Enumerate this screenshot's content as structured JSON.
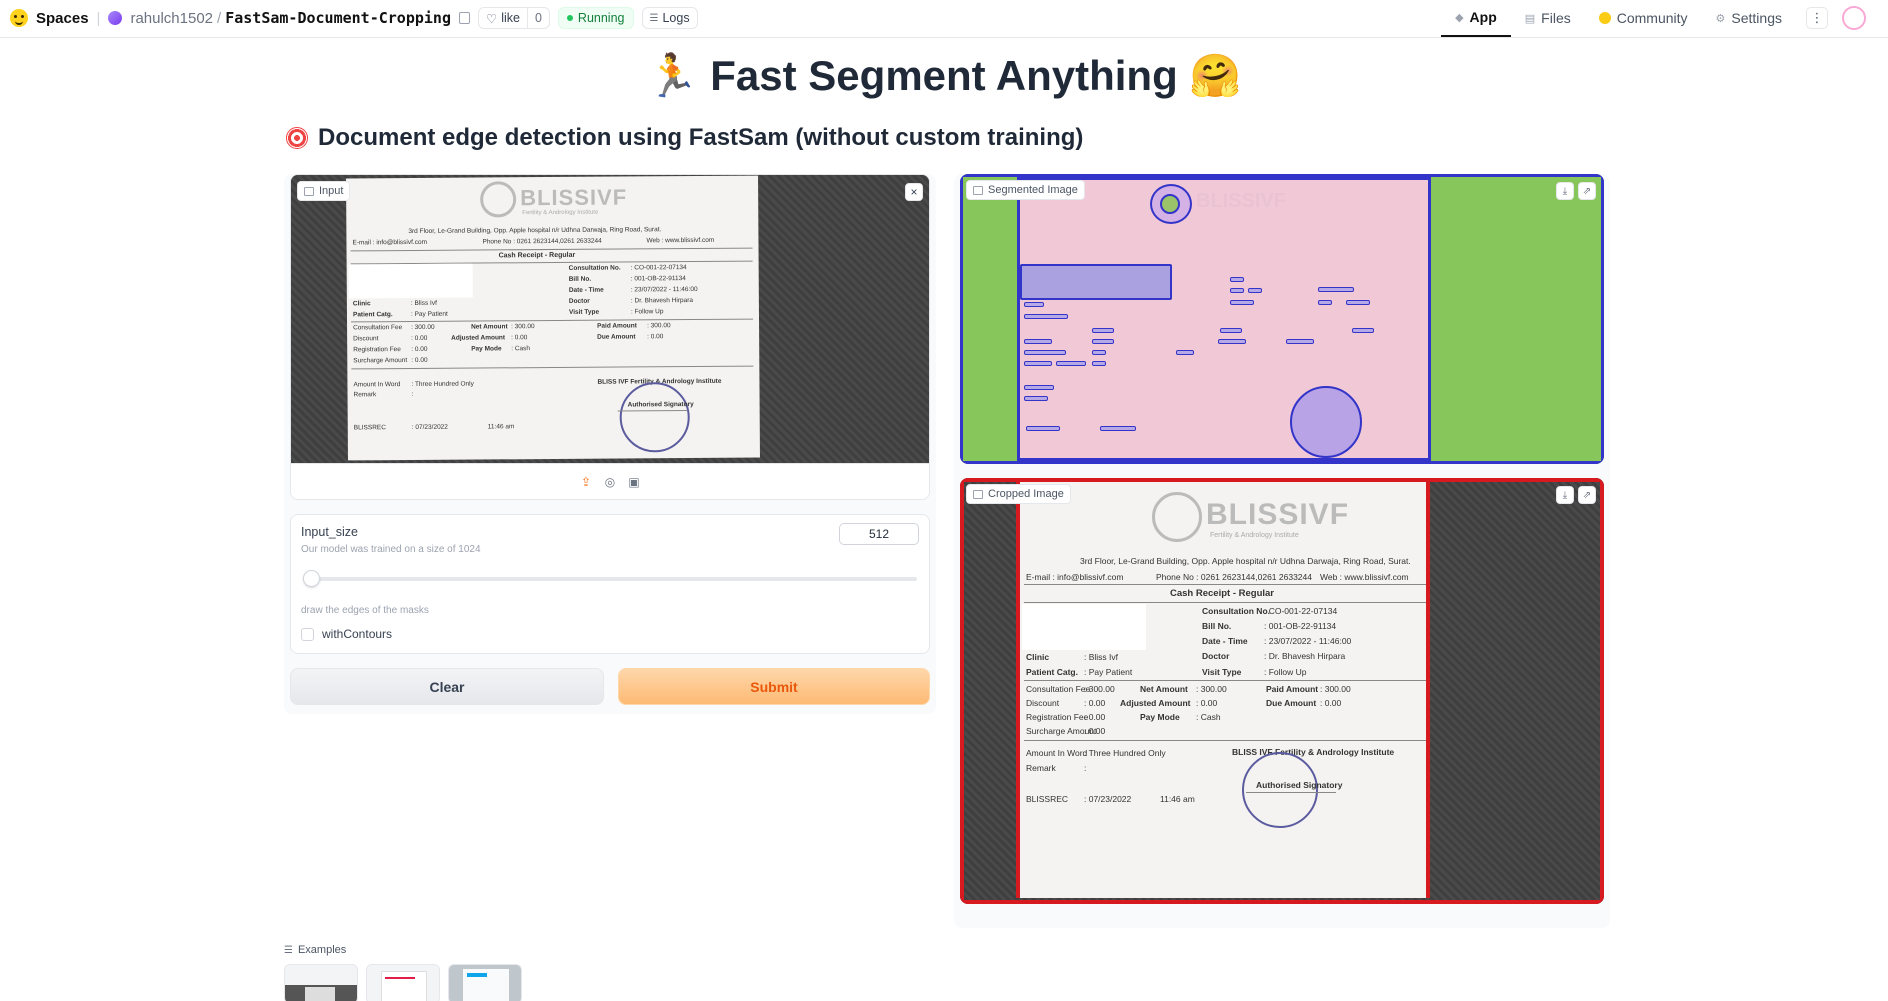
{
  "header": {
    "brand": "Spaces",
    "owner": "rahulch1502",
    "repo": "FastSam-Document-Cropping",
    "like_label": "like",
    "like_count": "0",
    "status": "Running",
    "logs_label": "Logs",
    "nav": {
      "app": "App",
      "files": "Files",
      "community": "Community",
      "settings": "Settings"
    }
  },
  "page": {
    "title": "🏃 Fast Segment Anything 🤗",
    "subtitle": "Document edge detection using FastSam (without custom training)"
  },
  "input_panel": {
    "label": "Input",
    "close": "×"
  },
  "input_size": {
    "title": "Input_size",
    "info": "Our model was trained on a size of 1024",
    "value": "512",
    "slider_fraction": 0.0
  },
  "contours": {
    "info": "draw the edges of the masks",
    "label": "withContours",
    "checked": false
  },
  "buttons": {
    "clear": "Clear",
    "submit": "Submit"
  },
  "outputs": {
    "segmented_label": "Segmented Image",
    "cropped_label": "Cropped Image"
  },
  "examples": {
    "label": "Examples"
  },
  "receipt": {
    "brand": "BLISSIVF",
    "brand_sub": "Fertility & Andrology Institute",
    "address": "3rd Floor, Le-Grand Building, Opp. Apple hospital n/r Udhna Darwaja, Ring Road, Surat.",
    "email": "E-mail : info@blissivf.com",
    "phone": "Phone No : 0261 2623144,0261 2633244",
    "web": "Web : www.blissivf.com",
    "heading": "Cash Receipt - Regular",
    "consultation_no_label": "Consultation No.",
    "consultation_no": ": CO-001-22-07134",
    "bill_no_label": "Bill No.",
    "bill_no": ": 001-OB-22-91134",
    "date_label": "Date - Time",
    "date": ": 23/07/2022 - 11:46:00",
    "clinic_label": "Clinic",
    "clinic": ": Bliss Ivf",
    "doctor_label": "Doctor",
    "doctor": ": Dr. Bhavesh Hirpara",
    "patient_label": "Patient Catg.",
    "patient": ": Pay Patient",
    "visit_label": "Visit Type",
    "visit": ": Follow Up",
    "fee_label": "Consultation Fee",
    "fee": ": 300.00",
    "net_label": "Net Amount",
    "net": ": 300.00",
    "paid_label": "Paid Amount",
    "paid": ": 300.00",
    "discount_label": "Discount",
    "discount": ": 0.00",
    "adjusted_label": "Adjusted Amount",
    "adjusted": ": 0.00",
    "due_label": "Due Amount",
    "due": ": 0.00",
    "registration_label": "Registration Fee",
    "registration": ": 0.00",
    "paymode_label": "Pay Mode",
    "paymode": ": Cash",
    "surcharge_label": "Surcharge Amount",
    "surcharge": ": 0.00",
    "words_label": "Amount In Word",
    "words": ": Three Hundred Only",
    "remark_label": "Remark",
    "remark": ":",
    "institute": "BLISS IVF Fertility & Andrology Institute",
    "signatory": "Authorised Signatory",
    "footer_code": "BLISSREC",
    "footer_date": ": 07/23/2022",
    "footer_time": "11:46 am"
  }
}
